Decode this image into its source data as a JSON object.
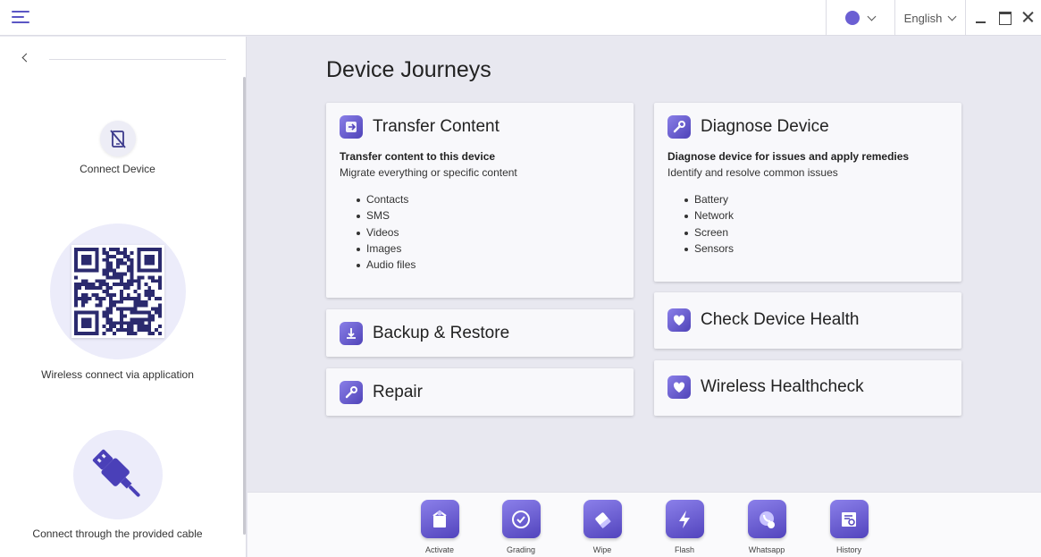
{
  "topbar": {
    "language": "English",
    "theme_color": "#6b5fd3"
  },
  "sidebar": {
    "connect_device_label": "Connect Device",
    "wireless_label": "Wireless connect via application",
    "cable_label": "Connect through the provided cable"
  },
  "main": {
    "title": "Device Journeys",
    "cards": {
      "transfer": {
        "title": "Transfer Content",
        "subtitle": "Transfer content to this device",
        "description": "Migrate everything or specific content",
        "items": [
          "Contacts",
          "SMS",
          "Videos",
          "Images",
          "Audio files"
        ]
      },
      "diagnose": {
        "title": "Diagnose Device",
        "subtitle": "Diagnose device for issues and apply remedies",
        "description": "Identify and resolve common issues",
        "items": [
          "Battery",
          "Network",
          "Screen",
          "Sensors"
        ]
      },
      "backup": {
        "title": "Backup & Restore"
      },
      "repair": {
        "title": "Repair"
      },
      "health": {
        "title": "Check Device Health"
      },
      "wireless_health": {
        "title": "Wireless Healthcheck"
      }
    }
  },
  "bottombar": {
    "items": [
      {
        "label": "Activate",
        "icon": "activate-icon"
      },
      {
        "label": "Grading",
        "icon": "grading-icon"
      },
      {
        "label": "Wipe",
        "icon": "eraser-icon"
      },
      {
        "label": "Flash",
        "icon": "flash-icon"
      },
      {
        "label": "Whatsapp",
        "icon": "whatsapp-icon"
      },
      {
        "label": "History",
        "icon": "history-icon"
      }
    ]
  },
  "colors": {
    "accent": "#5b4fc8",
    "background": "#e8e8f0"
  }
}
